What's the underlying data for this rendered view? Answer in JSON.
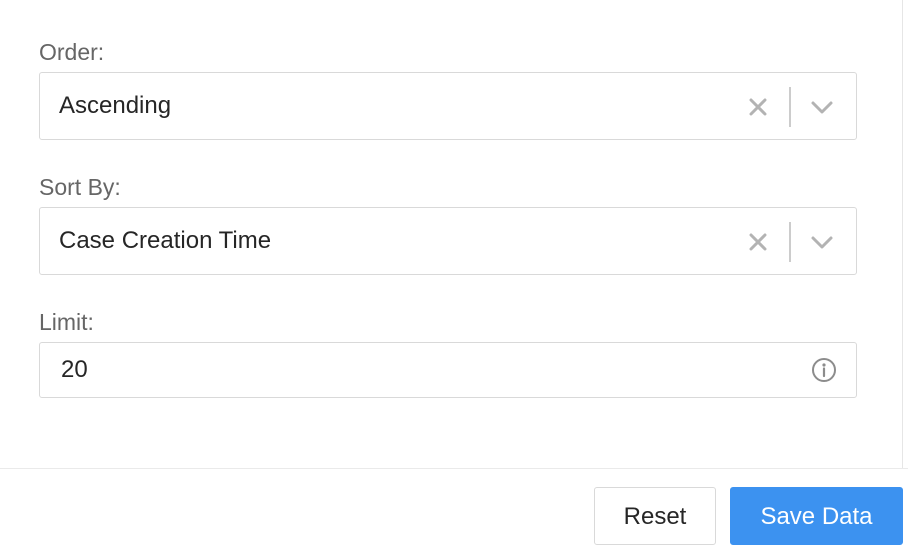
{
  "form": {
    "order": {
      "label": "Order:",
      "value": "Ascending"
    },
    "sort_by": {
      "label": "Sort By:",
      "value": "Case Creation Time"
    },
    "limit": {
      "label": "Limit:",
      "value": "20"
    }
  },
  "footer": {
    "reset_label": "Reset",
    "save_label": "Save Data"
  },
  "icons": {
    "clear": "close-icon",
    "dropdown": "chevron-down-icon",
    "info": "info-icon"
  },
  "colors": {
    "primary": "#3c92f0",
    "label_text": "#666666",
    "value_text": "#262626",
    "border": "#d9d9d9",
    "icon": "#aaaaaa"
  }
}
